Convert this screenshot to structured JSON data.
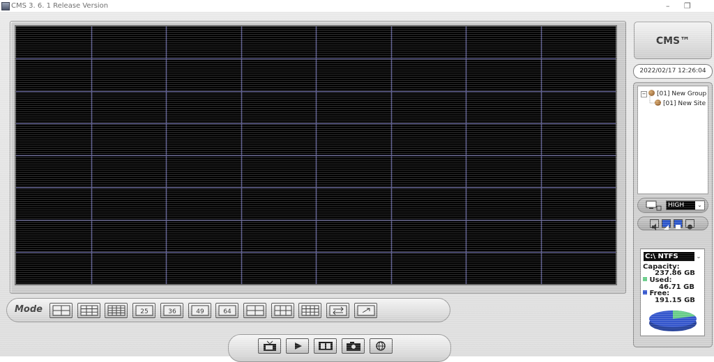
{
  "window": {
    "title": "CMS  3. 6. 1 Release Version",
    "minimize_glyph": "–",
    "restore_glyph": "❐"
  },
  "video_grid": {
    "rows": 8,
    "cols": 8,
    "background": "#000000",
    "line_color": "#5a5a8c"
  },
  "mode_bar": {
    "label": "Mode",
    "buttons": [
      {
        "id": "layout-4",
        "label": ""
      },
      {
        "id": "layout-9",
        "label": ""
      },
      {
        "id": "layout-16",
        "label": ""
      },
      {
        "id": "layout-25",
        "label": "25"
      },
      {
        "id": "layout-36",
        "label": "36"
      },
      {
        "id": "layout-49",
        "label": "49"
      },
      {
        "id": "layout-64",
        "label": "64"
      },
      {
        "id": "layout-pip",
        "label": ""
      },
      {
        "id": "layout-split",
        "label": ""
      },
      {
        "id": "layout-wide",
        "label": ""
      },
      {
        "id": "sequence",
        "label": ""
      },
      {
        "id": "fullscreen",
        "label": ""
      }
    ]
  },
  "playback_bar": {
    "buttons": [
      "live-tv-icon",
      "play-icon",
      "film-icon",
      "camera-snapshot-icon",
      "web-globe-icon"
    ]
  },
  "right_panel": {
    "logo": "CMS™",
    "datetime": "2022/02/17 12:26:04",
    "tree": {
      "group": "[01] New Group",
      "site": "[01] New Site",
      "expander": "−"
    },
    "quality": {
      "selected": "HIGH",
      "arrow": "⌄"
    },
    "disk": {
      "drive": "C:\\ NTFS",
      "arrow": "⌄",
      "capacity_label": "Capacity:",
      "capacity_value": "237.86 GB",
      "used_label": "Used:",
      "used_value": "46.71 GB",
      "free_label": "Free:",
      "free_value": "191.15 GB",
      "used_fraction": 0.196,
      "used_color": "#66cc88",
      "free_color": "#3355cc"
    }
  }
}
